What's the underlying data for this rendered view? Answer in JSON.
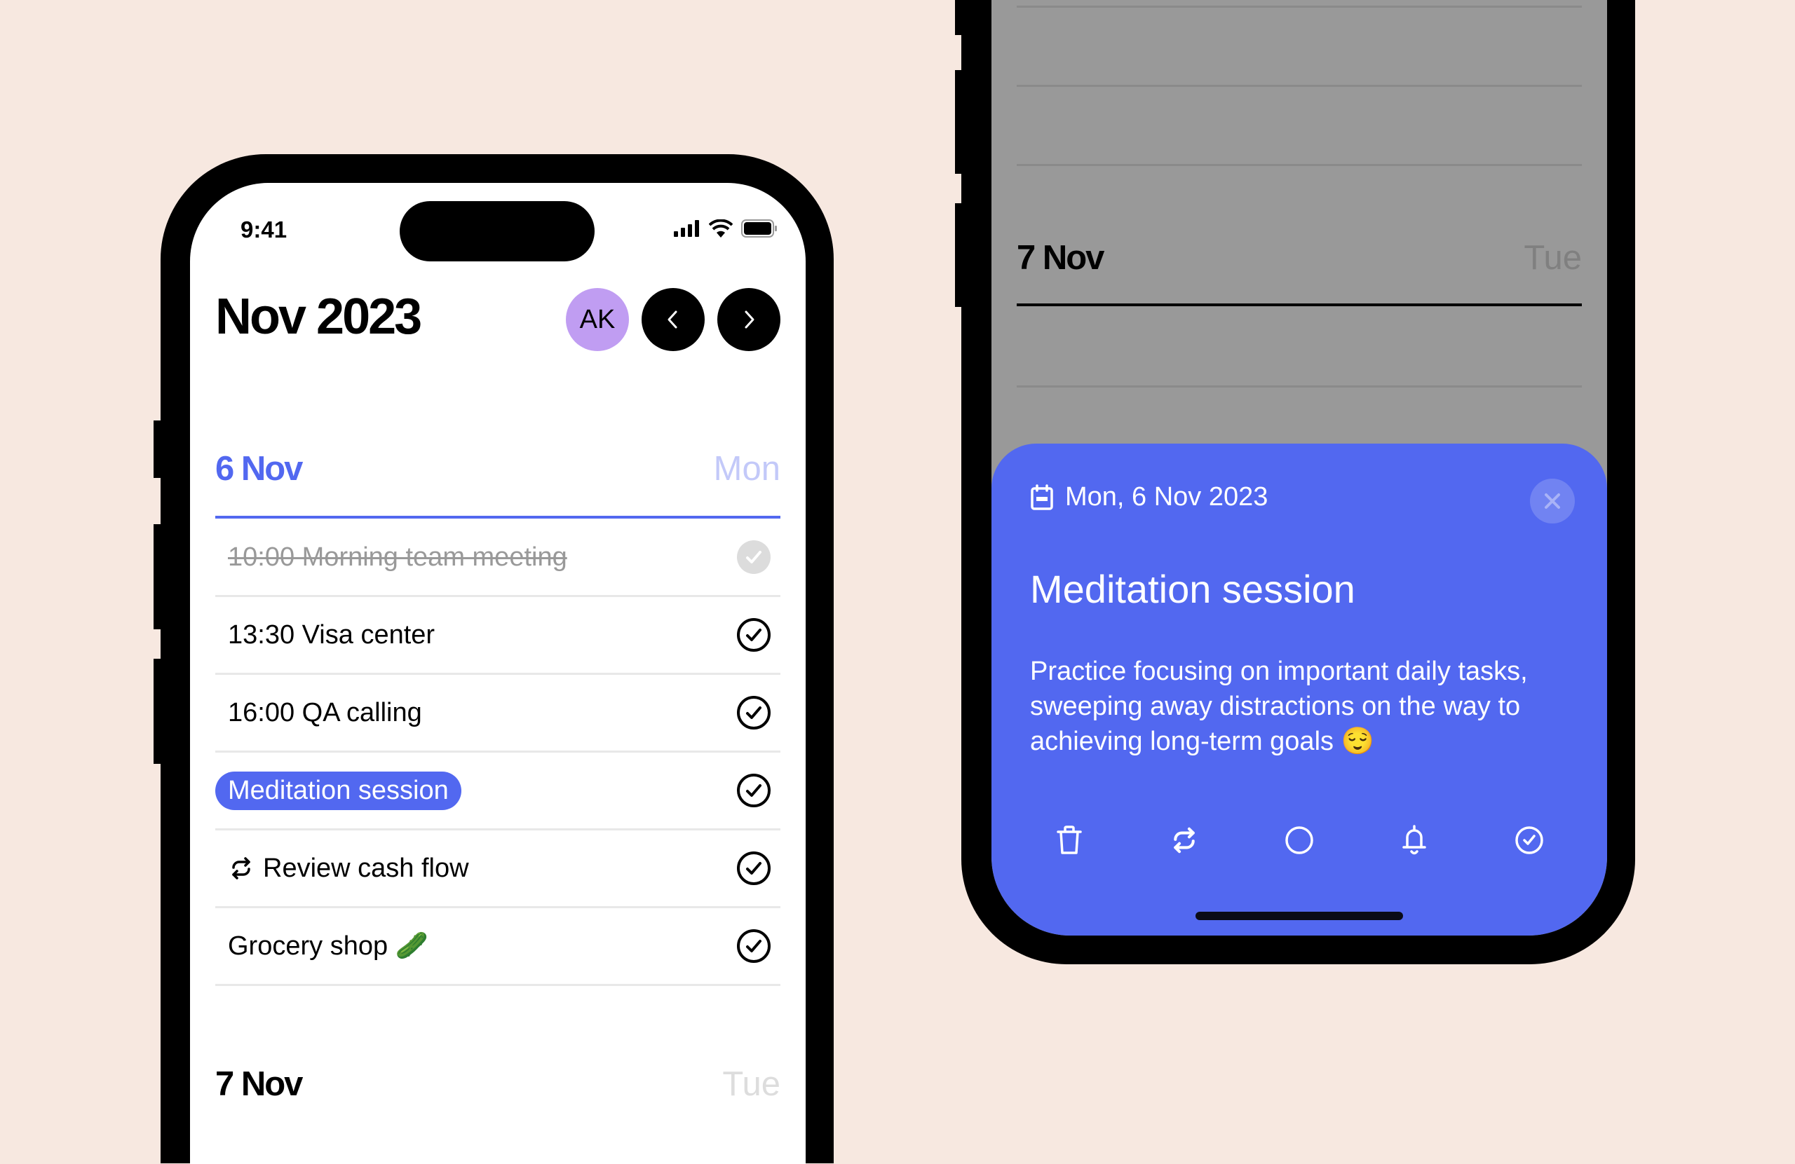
{
  "left_phone": {
    "status_bar": {
      "time": "9:41",
      "icons": [
        "signal-icon",
        "wifi-icon",
        "battery-icon"
      ]
    },
    "header": {
      "title": "Nov 2023",
      "avatar_initials": "AK",
      "prev_icon": "chevron-left-icon",
      "next_icon": "chevron-right-icon"
    },
    "days": [
      {
        "date": "6 Nov",
        "weekday": "Mon",
        "active": true,
        "tasks": [
          {
            "label": "10:00 Morning team meeting",
            "state": "done"
          },
          {
            "label": "13:30 Visa center",
            "state": "open"
          },
          {
            "label": "16:00 QA calling",
            "state": "open"
          },
          {
            "label": "Meditation session",
            "state": "selected"
          },
          {
            "label": "Review cash flow",
            "state": "open",
            "icon": "repeat-icon"
          },
          {
            "label": "Grocery shop 🥒",
            "state": "open"
          }
        ]
      },
      {
        "date": "7 Nov",
        "weekday": "Tue",
        "active": false
      }
    ]
  },
  "right_phone": {
    "background_day": {
      "date": "7 Nov",
      "weekday": "Tue"
    },
    "sheet": {
      "date_label": "Mon, 6 Nov 2023",
      "title": "Meditation session",
      "description": "Practice focusing on important daily tasks, sweeping away distractions on the way to achieving long-term goals 😌",
      "actions": [
        "trash-icon",
        "repeat-icon",
        "circle-icon",
        "bell-icon",
        "check-circle-icon"
      ]
    }
  },
  "colors": {
    "background": "#f7e8e0",
    "accent": "#5268f0",
    "accent_light": "#c3c9f9",
    "avatar": "#c09df2",
    "overlay": "#999999"
  }
}
